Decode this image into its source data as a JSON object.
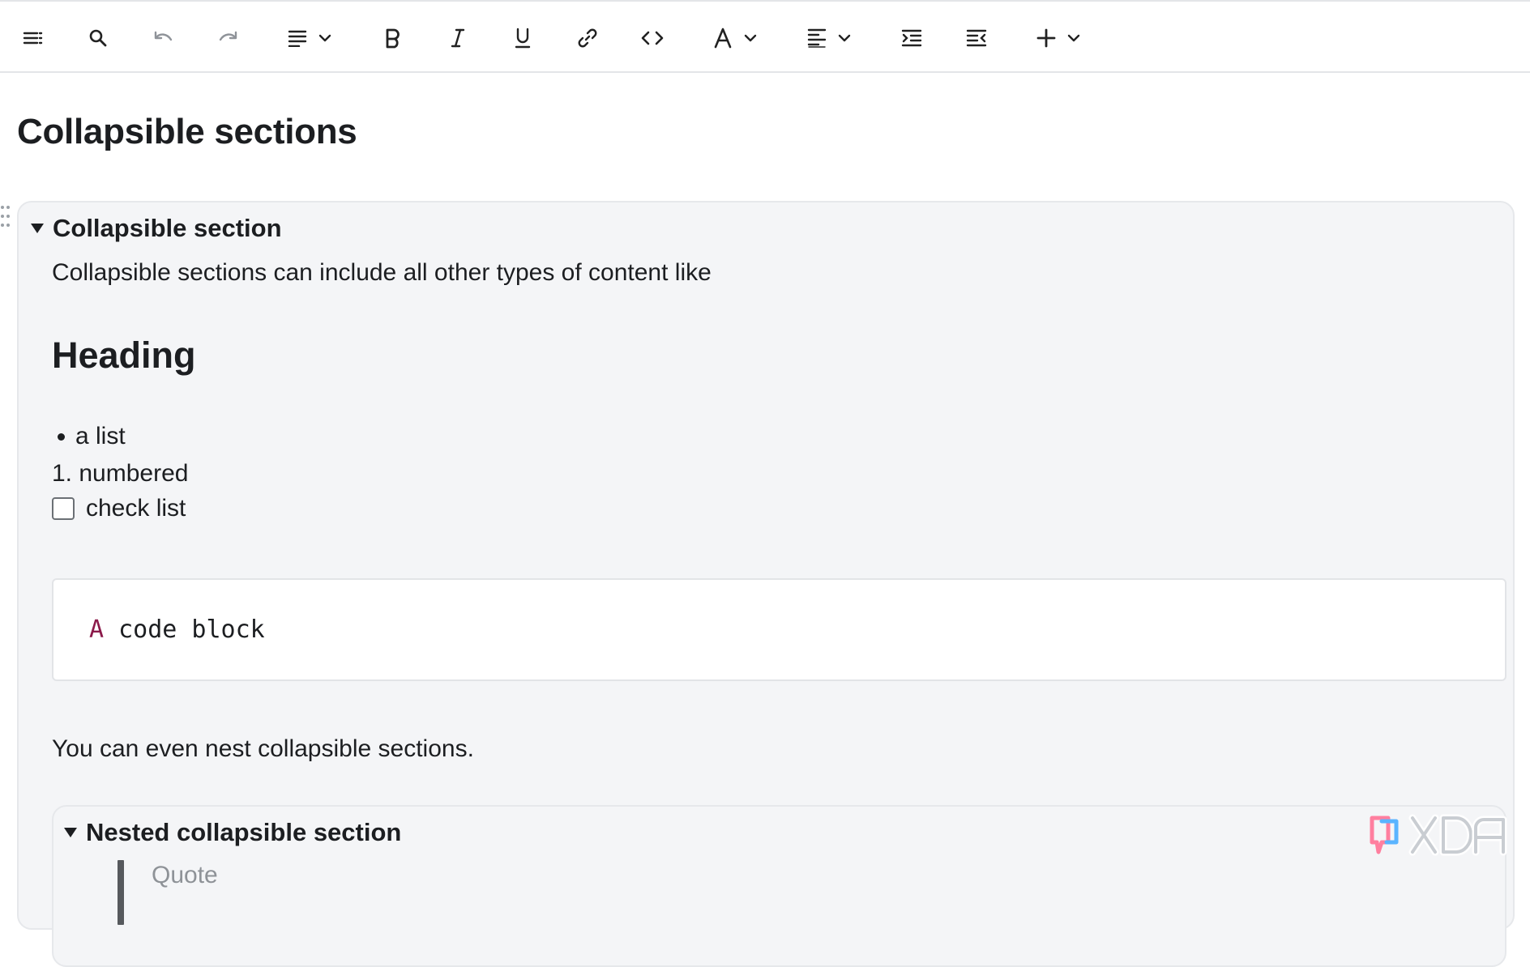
{
  "toolbar": {
    "items": [
      {
        "name": "menu-icon"
      },
      {
        "name": "search-icon"
      },
      {
        "name": "undo-icon"
      },
      {
        "name": "redo-icon"
      },
      {
        "name": "paragraph-style-icon"
      },
      {
        "name": "bold-icon"
      },
      {
        "name": "italic-icon"
      },
      {
        "name": "underline-icon"
      },
      {
        "name": "link-icon"
      },
      {
        "name": "code-icon"
      },
      {
        "name": "text-color-icon"
      },
      {
        "name": "align-icon"
      },
      {
        "name": "indent-icon"
      },
      {
        "name": "outdent-icon"
      },
      {
        "name": "insert-icon"
      }
    ]
  },
  "document": {
    "title": "Collapsible sections",
    "section": {
      "summary": "Collapsible section",
      "intro": "Collapsible sections can include all other types of content like",
      "heading": "Heading",
      "bullet_item": "a list",
      "numbered_item": "1. numbered",
      "check_item": "check list",
      "check_item_checked": false,
      "code_keyword": "A",
      "code_rest": " code block",
      "nest_text": "You can even nest collapsible sections.",
      "nested": {
        "summary": "Nested collapsible section",
        "quote": "Quote"
      }
    }
  },
  "colors": {
    "code_keyword": "#8b1a4a",
    "section_background": "#f4f5f7"
  },
  "watermark": {
    "text": "XDA"
  }
}
